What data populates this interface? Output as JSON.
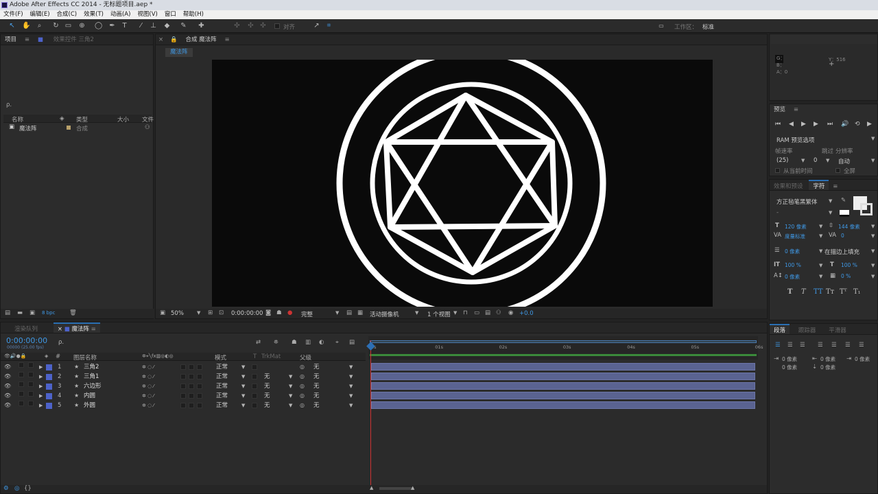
{
  "window": {
    "title": "Adobe After Effects CC 2014 - 无标题项目.aep *"
  },
  "menu": [
    "文件(F)",
    "编辑(E)",
    "合成(C)",
    "效果(T)",
    "动画(A)",
    "视图(V)",
    "窗口",
    "帮助(H)"
  ],
  "toolbar": {
    "align_label": "对齐",
    "workspace_label": "工作区：",
    "workspace_value": "标准"
  },
  "info": {
    "g": "G：",
    "b": "B：",
    "a": "A：0",
    "y": "Y：516"
  },
  "project": {
    "tab_project": "项目",
    "tab_effects": "效果控件 三角2",
    "search_placeholder": "ρ.",
    "columns": [
      "名称",
      "类型",
      "大小",
      "文件"
    ],
    "items": [
      {
        "name": "魔法阵",
        "type": "合成"
      }
    ],
    "bpc": "8 bpc"
  },
  "composition": {
    "tab_label": "合成 魔法阵",
    "sub_tab": "魔法阵",
    "zoom": "50%",
    "timecode": "0:00:00:00",
    "quality": "完整",
    "camera": "活动摄像机",
    "views": "1 个视图",
    "exposure": "+0.0"
  },
  "preview": {
    "title": "预览",
    "ram_options": "RAM 预览选项",
    "fps_label": "帧速率",
    "skip_label": "跳过",
    "resolution_label": "分辨率",
    "fps_value": "(25)",
    "skip_value": "0",
    "resolution_value": "自动",
    "from_current": "从当前时间",
    "fullscreen": "全屏"
  },
  "character": {
    "tab_effects_presets": "效果和预设",
    "tab_character": "字符",
    "font": "方正毡笔黑繁体",
    "style": "-",
    "size": "120 像素",
    "leading": "144 像素",
    "kerning": "度量标准",
    "tracking": "0",
    "stroke_width": "0 像素",
    "stroke_type": "在描边上填充",
    "v_scale": "100 %",
    "h_scale": "100 %",
    "baseline": "0 像素",
    "tsume": "0 %"
  },
  "paragraph": {
    "tab_paragraph": "段落",
    "tab_tracker": "跟踪器",
    "tab_smoother": "平滑器",
    "indent1": "0 像素",
    "indent2": "0 像素",
    "indent3": "0 像素",
    "space1": "0 像素",
    "space2": "0 像素"
  },
  "timeline": {
    "tab_render": "渲染队列",
    "tab_comp": "魔法阵",
    "timecode": "0:00:00:00",
    "timecode_sub": "00000 (25.00 fps)",
    "search_placeholder": "ρ.",
    "col_layer_name": "图层名称",
    "col_mode": "模式",
    "col_t": "T",
    "col_trkmat": "TrkMat",
    "col_parent": "父级",
    "ruler": [
      "0s",
      "01s",
      "02s",
      "03s",
      "04s",
      "05s",
      "06s"
    ],
    "layers": [
      {
        "num": "1",
        "name": "三角2",
        "mode": "正常",
        "trkmat": "",
        "parent": "无"
      },
      {
        "num": "2",
        "name": "三角1",
        "mode": "正常",
        "trkmat": "无",
        "parent": "无"
      },
      {
        "num": "3",
        "name": "六边形",
        "mode": "正常",
        "trkmat": "无",
        "parent": "无"
      },
      {
        "num": "4",
        "name": "内圆",
        "mode": "正常",
        "trkmat": "无",
        "parent": "无"
      },
      {
        "num": "5",
        "name": "外圆",
        "mode": "正常",
        "trkmat": "无",
        "parent": "无"
      }
    ],
    "label_color": "#4d62c9",
    "playhead_color": "#cc3333"
  }
}
